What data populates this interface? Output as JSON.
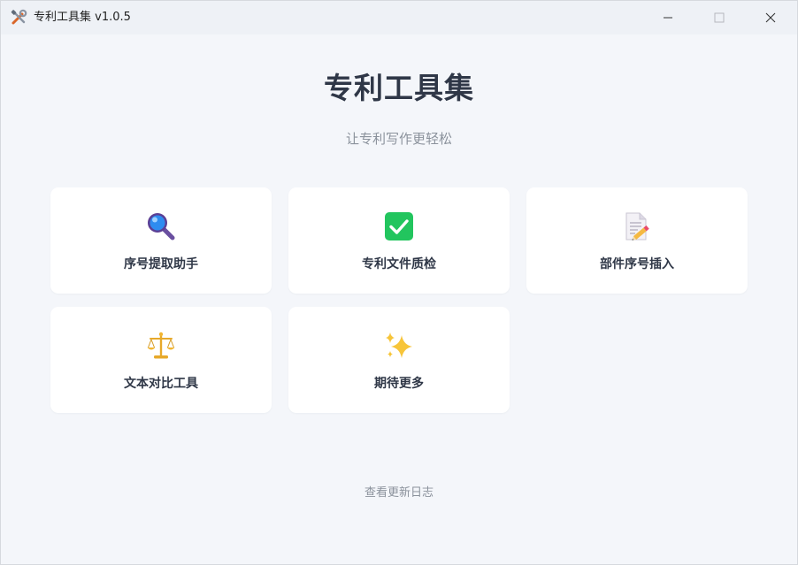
{
  "window": {
    "title": "专利工具集 v1.0.5",
    "app_icon": "tools-icon"
  },
  "main": {
    "title": "专利工具集",
    "subtitle": "让专利写作更轻松",
    "cards": [
      {
        "label": "序号提取助手",
        "icon": "magnifier-icon"
      },
      {
        "label": "专利文件质检",
        "icon": "checkmark-icon",
        "color": "#22c55e"
      },
      {
        "label": "部件序号插入",
        "icon": "document-pencil-icon"
      },
      {
        "label": "文本对比工具",
        "icon": "balance-scale-icon"
      },
      {
        "label": "期待更多",
        "icon": "sparkles-icon"
      }
    ]
  },
  "footer": {
    "changelog_link": "查看更新日志"
  },
  "colors": {
    "background": "#f4f6fa",
    "card": "#ffffff",
    "heading": "#2f3747",
    "muted": "#8b929c"
  }
}
